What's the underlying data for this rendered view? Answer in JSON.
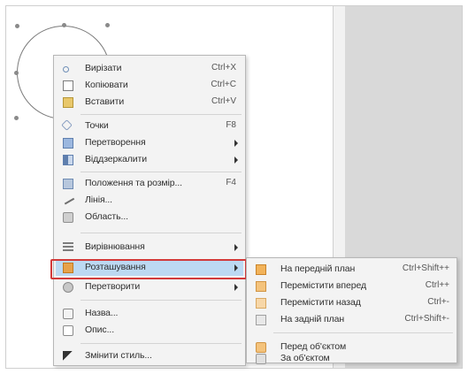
{
  "context_menu": {
    "items": [
      {
        "label": "Вирізати",
        "shortcut": "Ctrl+X",
        "icon": "scissors-icon"
      },
      {
        "label": "Копіювати",
        "shortcut": "Ctrl+C",
        "icon": "copy-icon"
      },
      {
        "label": "Вставити",
        "shortcut": "Ctrl+V",
        "icon": "paste-icon"
      },
      {
        "label": "Точки",
        "shortcut": "F8",
        "icon": "points-icon"
      },
      {
        "label": "Перетворення",
        "shortcut": "",
        "icon": "transform-icon"
      },
      {
        "label": "Віддзеркалити",
        "shortcut": "",
        "icon": "mirror-icon"
      },
      {
        "label": "Положення та розмір...",
        "shortcut": "F4",
        "icon": "position-size-icon"
      },
      {
        "label": "Лінія...",
        "shortcut": "",
        "icon": "line-icon"
      },
      {
        "label": "Область...",
        "shortcut": "",
        "icon": "area-icon"
      },
      {
        "label": "Вирівнювання",
        "shortcut": "",
        "icon": "align-icon"
      },
      {
        "label": "Розташування",
        "shortcut": "",
        "icon": "arrange-icon"
      },
      {
        "label": "Перетворити",
        "shortcut": "",
        "icon": "convert-icon"
      },
      {
        "label": "Назва...",
        "shortcut": "",
        "icon": "name-icon"
      },
      {
        "label": "Опис...",
        "shortcut": "",
        "icon": "description-icon"
      },
      {
        "label": "Змінити стиль...",
        "shortcut": "",
        "icon": "style-icon"
      }
    ]
  },
  "arrange_submenu": {
    "items": [
      {
        "label": "На передній план",
        "shortcut": "Ctrl+Shift++",
        "icon": "bring-to-front-icon"
      },
      {
        "label": "Перемістити вперед",
        "shortcut": "Ctrl++",
        "icon": "bring-forward-icon"
      },
      {
        "label": "Перемістити назад",
        "shortcut": "Ctrl+-",
        "icon": "send-backward-icon"
      },
      {
        "label": "На задній план",
        "shortcut": "Ctrl+Shift+-",
        "icon": "send-to-back-icon"
      },
      {
        "label": "Перед об'єктом",
        "shortcut": "",
        "icon": "in-front-of-object-icon"
      },
      {
        "label": "За об'єктом",
        "shortcut": "",
        "icon": "behind-object-icon"
      }
    ]
  },
  "colors": {
    "highlight": "#bcd9f2",
    "callout_border": "#d23a3a",
    "side_panel": "#d9d9d9"
  }
}
